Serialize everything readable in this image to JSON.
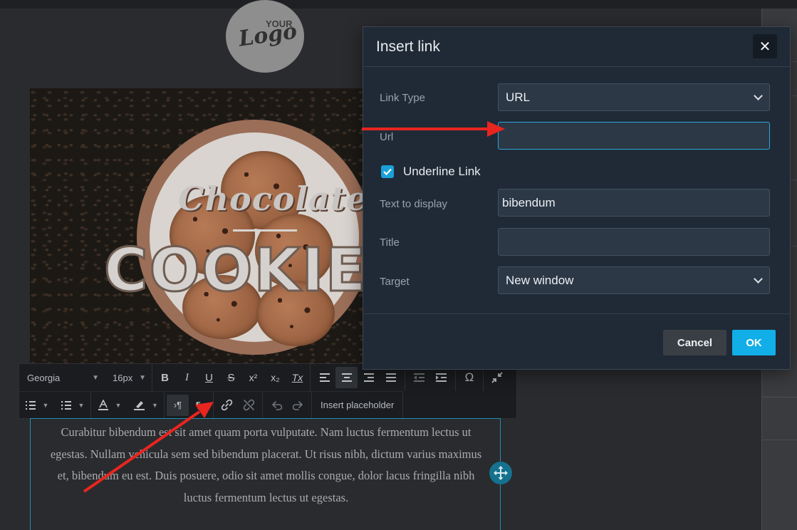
{
  "logo": {
    "line1": "YOUR",
    "line2": "Logo"
  },
  "hero": {
    "title_script": "Chocolate",
    "title_bold": "COOKIE"
  },
  "toolbar": {
    "font_family": "Georgia",
    "font_size": "16px",
    "bold_glyph": "B",
    "italic_glyph": "I",
    "underline_glyph": "U",
    "strike_glyph": "S",
    "superscript_glyph": "x²",
    "subscript_glyph": "x₂",
    "clear_format_glyph": "Tx",
    "special_char_glyph": "Ω",
    "insert_placeholder_label": "Insert placeholder"
  },
  "paragraph": {
    "text": "Curabitur bibendum est sit amet quam porta vulputate. Nam luctus fermentum lectus ut egestas. Nullam vehicula sem sed bibendum placerat. Ut risus nibh, dictum varius maximus et, bibendum eu est. Duis posuere, odio sit amet mollis congue, dolor lacus fringilla nibh luctus fermentum lectus ut egestas."
  },
  "dialog": {
    "title": "Insert link",
    "close_glyph": "✕",
    "link_type_label": "Link Type",
    "link_type_value": "URL",
    "url_label": "Url",
    "url_value": "",
    "underline_label": "Underline Link",
    "underline_checked": true,
    "text_label": "Text to display",
    "text_value": "bibendum",
    "title_label": "Title",
    "title_value": "",
    "target_label": "Target",
    "target_value": "New window",
    "cancel_label": "Cancel",
    "ok_label": "OK"
  },
  "colors": {
    "accent": "#11aee8",
    "annotation_arrow": "#e8251f",
    "dialog_bg": "#1f2a36"
  }
}
